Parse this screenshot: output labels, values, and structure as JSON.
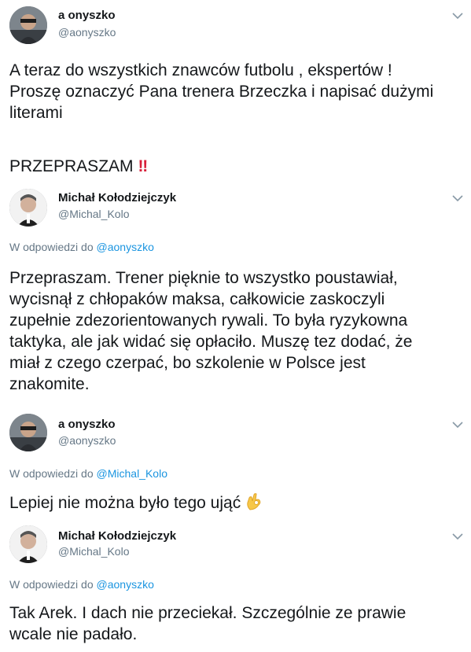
{
  "tweets": [
    {
      "author_name": "a onyszko",
      "author_handle": "@aonyszko",
      "replying_prefix": "",
      "replying_to": "",
      "text_lines": [
        "A teraz do wszystkich znawców futbolu , ekspertów !",
        "Proszę oznaczyć Pana trenera Brzeczka i napisać dużymi",
        "literami"
      ],
      "extra_text": "PRZEPRASZAM",
      "extra_emoji": "‼"
    },
    {
      "author_name": "Michał Kołodziejczyk",
      "author_handle": "@Michal_Kolo",
      "replying_prefix": "W odpowiedzi do",
      "replying_to": "@aonyszko",
      "text_lines": [
        "Przepraszam. Trener pięknie to wszystko poustawiał,",
        "wycisnął z chłopaków maksa, całkowicie zaskoczyli",
        "zupełnie zdezorientowanych rywali. To była ryzykowna",
        "taktyka, ale jak widać się opłaciło. Muszę tez dodać, że",
        "miał z czego czerpać, bo szkolenie w Polsce jest",
        "znakomite."
      ]
    },
    {
      "author_name": "a onyszko",
      "author_handle": "@aonyszko",
      "replying_prefix": "W odpowiedzi do",
      "replying_to": "@Michal_Kolo",
      "text_lines": [
        "Lepiej nie można było tego ująć"
      ],
      "emoji": "ok-hand-icon"
    },
    {
      "author_name": "Michał Kołodziejczyk",
      "author_handle": "@Michal_Kolo",
      "replying_prefix": "W odpowiedzi do",
      "replying_to": "@aonyszko",
      "text_lines": [
        "Tak Arek. I dach nie przeciekał. Szczególnie ze prawie",
        "wcale nie padało."
      ]
    }
  ],
  "colors": {
    "text": "#14171a",
    "secondary": "#657786",
    "link": "#1b95e0",
    "emoji_red": "#d8203a"
  }
}
